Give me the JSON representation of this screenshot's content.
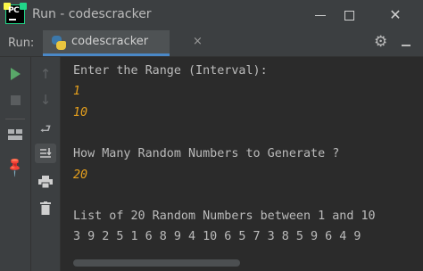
{
  "window": {
    "title": "Run - codescracker",
    "app_icon_text": "PC"
  },
  "run_panel": {
    "label": "Run:",
    "tab_label": "codescracker",
    "tab_close": "×"
  },
  "console": {
    "lines": [
      {
        "text": "Enter the Range (Interval):",
        "kind": "output"
      },
      {
        "text": "1",
        "kind": "input"
      },
      {
        "text": "10",
        "kind": "input"
      },
      {
        "text": "",
        "kind": "blank"
      },
      {
        "text": "How Many Random Numbers to Generate ?",
        "kind": "output"
      },
      {
        "text": "20",
        "kind": "input"
      },
      {
        "text": "",
        "kind": "blank"
      },
      {
        "text": "List of 20 Random Numbers between 1 and 10",
        "kind": "output"
      },
      {
        "text": "3 9 2 5 1 6 8 9 4 10 6 5 7 3 8 5 9 6 4 9",
        "kind": "output"
      }
    ]
  },
  "colors": {
    "input_text": "#e6a01d",
    "output_text": "#bbbbbb",
    "run_green": "#59a869",
    "tab_underline": "#4a88c7"
  }
}
